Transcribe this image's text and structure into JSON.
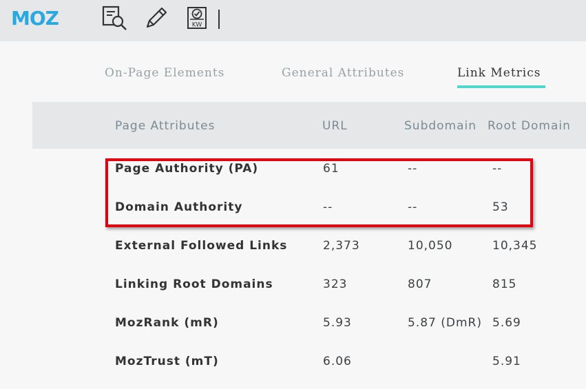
{
  "toolbar": {
    "logo": "MOZ",
    "icons": [
      "page-analysis-icon",
      "edit-pencil-icon",
      "keyword-icon"
    ],
    "keyword_icon_text": "KW"
  },
  "tabs": [
    {
      "label": "On-Page Elements",
      "active": false
    },
    {
      "label": "General Attributes",
      "active": false
    },
    {
      "label": "Link Metrics",
      "active": true
    }
  ],
  "table": {
    "headers": [
      "Page Attributes",
      "URL",
      "Subdomain",
      "Root Domain"
    ],
    "rows": [
      {
        "label": "Page Authority (PA)",
        "url": "61",
        "subdomain": "--",
        "root": "--"
      },
      {
        "label": "Domain Authority",
        "url": "--",
        "subdomain": "--",
        "root": "53"
      },
      {
        "label": "External Followed Links",
        "url": "2,373",
        "subdomain": "10,050",
        "root": "10,345"
      },
      {
        "label": "Linking Root Domains",
        "url": "323",
        "subdomain": "807",
        "root": "815"
      },
      {
        "label": "MozRank (mR)",
        "url": "5.93",
        "subdomain": "5.87 (DmR)",
        "root": "5.69"
      },
      {
        "label": "MozTrust (mT)",
        "url": "6.06",
        "subdomain": "",
        "root": "5.91"
      }
    ]
  },
  "colors": {
    "brand": "#2aa8e0",
    "active_tab_underline": "#4fd6cd",
    "highlight_box": "#e00010"
  }
}
